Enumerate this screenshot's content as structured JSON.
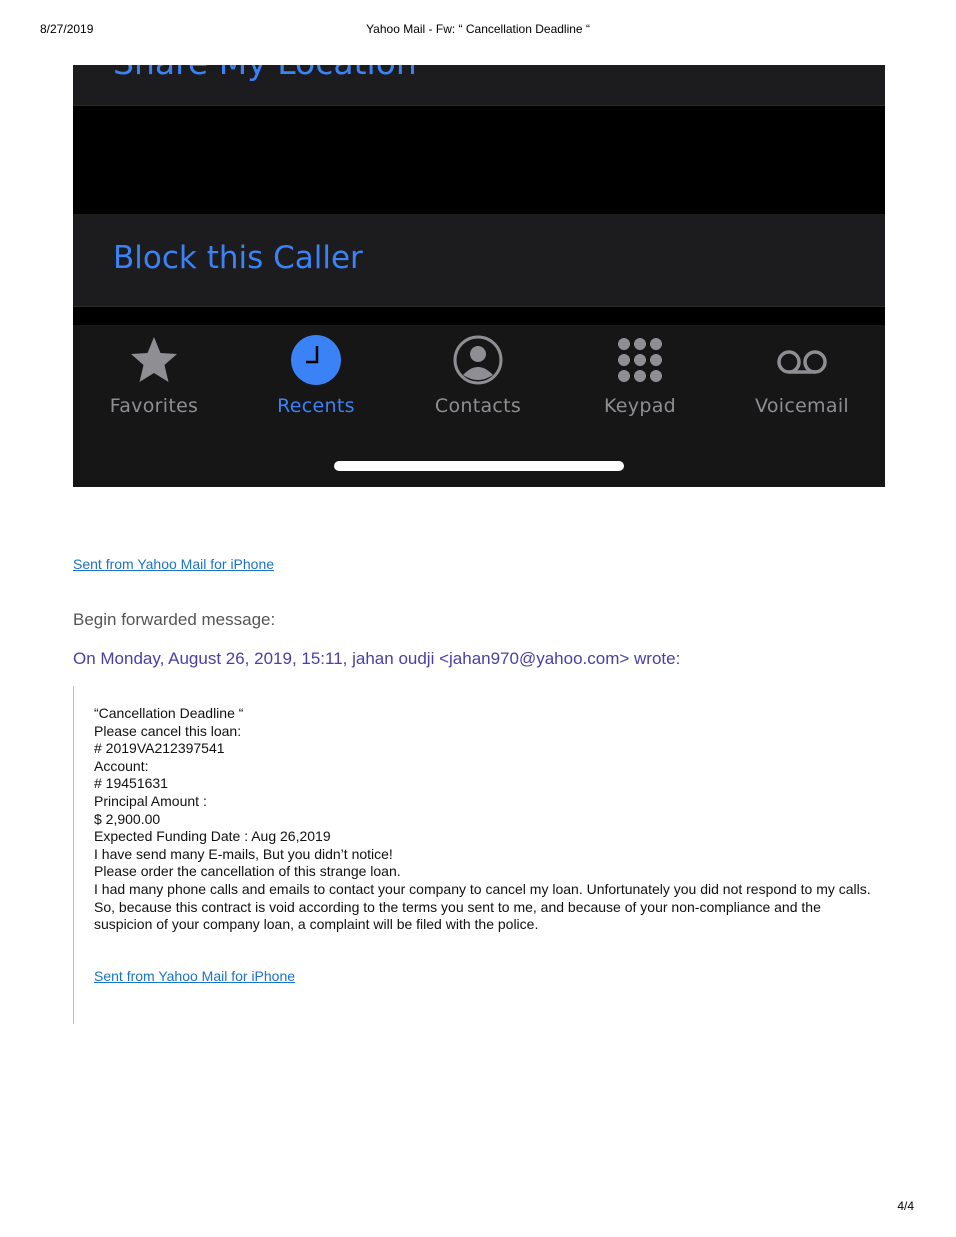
{
  "print_header": {
    "date": "8/27/2019",
    "title": "Yahoo Mail - Fw: “ Cancellation Deadline “"
  },
  "page_number": "4/4",
  "phone_screenshot": {
    "rows": {
      "share_location": "Share My Location",
      "block_caller": "Block this Caller"
    },
    "tabs": [
      {
        "label": "Favorites",
        "icon": "star-icon",
        "active": false
      },
      {
        "label": "Recents",
        "icon": "clock-icon",
        "active": true
      },
      {
        "label": "Contacts",
        "icon": "person-circle-icon",
        "active": false
      },
      {
        "label": "Keypad",
        "icon": "keypad-icon",
        "active": false
      },
      {
        "label": "Voicemail",
        "icon": "voicemail-icon",
        "active": false
      }
    ],
    "colors": {
      "accent": "#3b82f6",
      "inactive": "#8e8e93",
      "background": "#000000"
    }
  },
  "email": {
    "signature_link": "Sent from Yahoo Mail for iPhone",
    "begin_forwarded": "Begin forwarded message:",
    "wrote_line": "On Monday, August 26, 2019, 15:11, jahan oudji <jahan970@yahoo.com> wrote:",
    "quoted_lines": [
      "“Cancellation Deadline “",
      "Please cancel this loan:",
      "# 2019VA212397541",
      "Account:",
      "# 19451631",
      "Principal Amount :",
      "$ 2,900.00",
      "Expected Funding Date : Aug 26,2019",
      "I have send many E-mails, But you didn’t notice!",
      "Please order the cancellation of this strange loan.",
      "I had many phone calls and emails to contact your company to cancel my loan. Unfortunately you did not respond to my calls. So, because this contract is void according to the terms you sent to me, and because of your non-compliance and the suspicion of your company loan, a complaint will be filed with the police."
    ],
    "quoted_signature_link": "Sent from Yahoo Mail for iPhone"
  }
}
